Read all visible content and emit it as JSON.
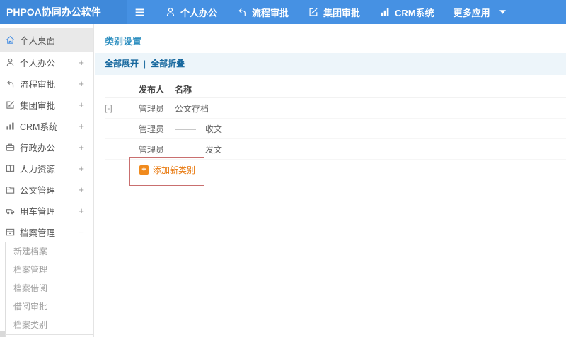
{
  "colors": {
    "header-bg": "#4691e3",
    "logo-bg": "#3f89da",
    "accent-blue": "#4a90e2",
    "title-blue": "#2e8fc0",
    "link-blue": "#17689e",
    "toolbar-bg": "#edf5fa",
    "add-orange": "#e8790f",
    "annotation-red": "#c96f6f"
  },
  "header": {
    "logo": "PHPOA协同办公软件",
    "menu_icon": "menu-icon",
    "nav": [
      {
        "label": "个人办公",
        "icon": "user-icon"
      },
      {
        "label": "流程审批",
        "icon": "flow-icon"
      },
      {
        "label": "集团审批",
        "icon": "edit-icon"
      },
      {
        "label": "CRM系统",
        "icon": "chart-icon"
      },
      {
        "label": "更多应用",
        "caret": true
      }
    ]
  },
  "sidebar": {
    "items": [
      {
        "label": "个人桌面",
        "icon": "home-icon",
        "toggle": "",
        "selected": true
      },
      {
        "label": "个人办公",
        "icon": "user-icon",
        "toggle": "+"
      },
      {
        "label": "流程审批",
        "icon": "flow-icon",
        "toggle": "+"
      },
      {
        "label": "集团审批",
        "icon": "edit-icon",
        "toggle": "+"
      },
      {
        "label": "CRM系统",
        "icon": "chart-icon",
        "toggle": "+"
      },
      {
        "label": "行政办公",
        "icon": "briefcase-icon",
        "toggle": "+"
      },
      {
        "label": "人力资源",
        "icon": "book-icon",
        "toggle": "+"
      },
      {
        "label": "公文管理",
        "icon": "doc-folder-icon",
        "toggle": "+"
      },
      {
        "label": "用车管理",
        "icon": "car-icon",
        "toggle": "+"
      },
      {
        "label": "档案管理",
        "icon": "archive-icon",
        "toggle": "−"
      }
    ],
    "submenu": [
      "新建档案",
      "档案管理",
      "档案借阅",
      "借阅审批",
      "档案类别"
    ]
  },
  "main": {
    "title": "类别设置",
    "toolbar": {
      "expand_all": "全部展开",
      "separator": "|",
      "collapse_all": "全部折叠"
    },
    "table": {
      "columns": {
        "publisher": "发布人",
        "name": "名称"
      },
      "rows": [
        {
          "toggle": "[-]",
          "publisher": "管理员",
          "name": "公文存档",
          "child": false
        },
        {
          "toggle": "",
          "publisher": "管理员",
          "name": "收文",
          "child": true
        },
        {
          "toggle": "",
          "publisher": "管理员",
          "name": "发文",
          "child": true
        }
      ]
    },
    "add_button": {
      "label": "添加新类别",
      "plus": "+",
      "icon": "plus-icon"
    }
  }
}
